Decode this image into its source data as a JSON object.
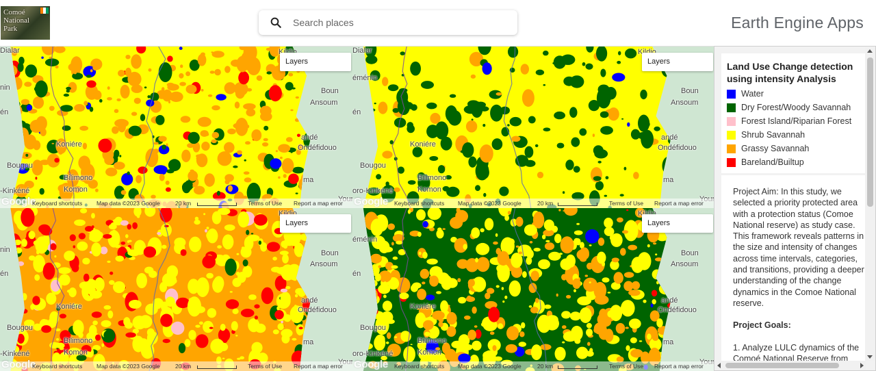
{
  "header": {
    "logo_text": "Comoé National Park",
    "logo_flag_colors": [
      "#f77f00",
      "#ffffff",
      "#009e60"
    ],
    "search_placeholder": "Search places",
    "app_title": "Earth Engine Apps"
  },
  "land_cover_colors": {
    "water": "#0000ff",
    "dry_forest": "#006400",
    "forest_island": "#ffc0cb",
    "shrub_savannah": "#ffff00",
    "grassy_savannah": "#ffa500",
    "bareland": "#ff0000"
  },
  "maps": [
    {
      "id": "top-left",
      "layers_label": "Layers",
      "dominant": "mixed-yellow-orange",
      "places": [
        {
          "name": "Dialar"
        },
        {
          "name": "Kildio"
        },
        {
          "name": "Boun"
        },
        {
          "name": "Ansoum"
        },
        {
          "name": "andé"
        },
        {
          "name": "Ondéfidouo"
        },
        {
          "name": "Koniére"
        },
        {
          "name": "Bougou"
        },
        {
          "name": "Bilimono"
        },
        {
          "name": "Komon"
        },
        {
          "name": "ma"
        },
        {
          "name": "-Kinkéné"
        },
        {
          "name": "Youn"
        },
        {
          "name": "nin"
        },
        {
          "name": "én"
        }
      ]
    },
    {
      "id": "top-right",
      "layers_label": "Layers",
      "dominant": "yellow",
      "places": [
        {
          "name": "Dialar"
        },
        {
          "name": "Kildio"
        },
        {
          "name": "Boun"
        },
        {
          "name": "Ansoum"
        },
        {
          "name": "andé"
        },
        {
          "name": "Ondéfidouo"
        },
        {
          "name": "Koniére"
        },
        {
          "name": "Bougou"
        },
        {
          "name": "Bilimono"
        },
        {
          "name": "Komon"
        },
        {
          "name": "ma"
        },
        {
          "name": "oro-Kinkéné"
        },
        {
          "name": "Youn"
        },
        {
          "name": "éménin"
        },
        {
          "name": "én"
        }
      ]
    },
    {
      "id": "bottom-left",
      "layers_label": "Layers",
      "dominant": "orange-red",
      "places": [
        {
          "name": "Kildio"
        },
        {
          "name": "Boun"
        },
        {
          "name": "Ansoum"
        },
        {
          "name": "andé"
        },
        {
          "name": "Ondéfidouo"
        },
        {
          "name": "Koniére"
        },
        {
          "name": "Bougou"
        },
        {
          "name": "Bilimono"
        },
        {
          "name": "Komon"
        },
        {
          "name": "ma"
        },
        {
          "name": "-Kinkéné"
        },
        {
          "name": "Youn"
        },
        {
          "name": "nin"
        },
        {
          "name": "én"
        }
      ]
    },
    {
      "id": "bottom-right",
      "layers_label": "Layers",
      "dominant": "green",
      "places": [
        {
          "name": "Kildio"
        },
        {
          "name": "Boun"
        },
        {
          "name": "Ansoum"
        },
        {
          "name": "andé"
        },
        {
          "name": "Ondéfidouo"
        },
        {
          "name": "Koniére"
        },
        {
          "name": "Bougou"
        },
        {
          "name": "Bilimono"
        },
        {
          "name": "Komon"
        },
        {
          "name": "ma"
        },
        {
          "name": "oro-Kinkéné"
        },
        {
          "name": "Youn"
        },
        {
          "name": "éménin"
        },
        {
          "name": "én"
        }
      ]
    }
  ],
  "map_footer": {
    "google": "Google",
    "keyboard": "Keyboard shortcuts",
    "map_data": "Map data ©2023 Google",
    "scale": "20 km",
    "terms": "Terms of Use",
    "report": "Report a map error"
  },
  "legend": {
    "title": "Land Use Change detection using intensity Analysis",
    "items": [
      {
        "label": "Water",
        "color": "#0000ff"
      },
      {
        "label": "Dry Forest/Woody Savannah",
        "color": "#006400"
      },
      {
        "label": "Forest Island/Riparian Forest",
        "color": "#ffc0cb"
      },
      {
        "label": "Shrub Savannah",
        "color": "#ffff00"
      },
      {
        "label": "Grassy Savannah",
        "color": "#ffa500"
      },
      {
        "label": "Bareland/Builtup",
        "color": "#ff0000"
      }
    ]
  },
  "description": {
    "aim": "Project Aim: In this study, we selected a priority protected area with a protection status (Comoe National reserve) as study case. This framework reveals patterns in the size and intensity of changes across time intervals, categories, and transitions, providing a deeper understanding of the change dynamics in the Comoe National reserve.",
    "goals_title": "Project Goals:",
    "goal_1": "1. Analyze LULC dynamics of the Comoé National Reserve from"
  }
}
